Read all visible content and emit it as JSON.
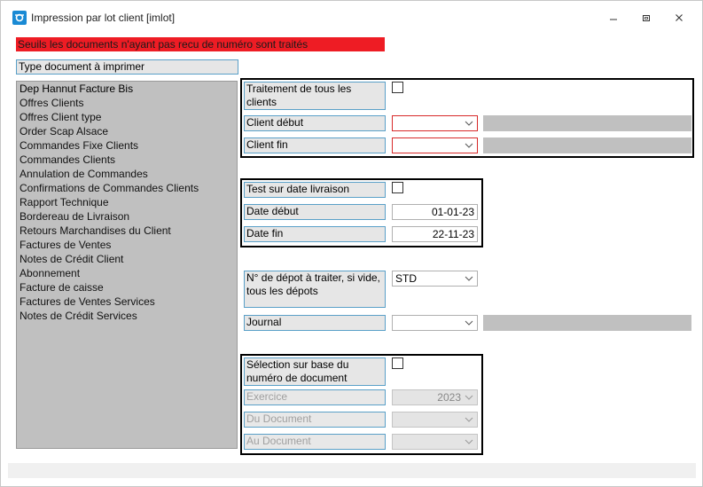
{
  "window": {
    "title": "Impression par lot client [imlot]"
  },
  "warning": "Seuils les documents n'ayant pas recu de numéro sont traités",
  "doctype_label": "Type document à imprimer",
  "documents": [
    "Dep Hannut Facture Bis",
    "Offres Clients",
    "Offres Client type",
    "Order Scap Alsace",
    "Commandes Fixe Clients",
    "Commandes Clients",
    "Annulation de Commandes",
    "Confirmations de Commandes Clients",
    "Rapport Technique",
    "Bordereau de Livraison",
    "Retours Marchandises du Client",
    "Factures de Ventes",
    "Notes de Crédit Client",
    "Abonnement",
    "Facture de caisse",
    "Factures de Ventes Services",
    "Notes de Crédit Services"
  ],
  "clients": {
    "all_label": "Traitement de tous les clients",
    "start_label": "Client début",
    "end_label": "Client fin",
    "start_value": "",
    "end_value": ""
  },
  "dates": {
    "test_label": "Test sur date livraison",
    "start_label": "Date début",
    "start_value": "01-01-23",
    "end_label": "Date fin",
    "end_value": "22-11-23"
  },
  "depot": {
    "label": "N° de dépot à traiter, si vide, tous les dépots",
    "value": "STD"
  },
  "journal": {
    "label": "Journal",
    "value": ""
  },
  "docnum": {
    "selection_label": "Sélection sur base du numéro de document",
    "exercice_label": "Exercice",
    "exercice_value": "2023",
    "from_label": "Du Document",
    "to_label": "Au Document"
  },
  "colors": {
    "warning": "#ee1c24",
    "label_border": "#5aa0c8",
    "list_bg": "#c0c0c0",
    "accent": "#1a8ad4"
  }
}
